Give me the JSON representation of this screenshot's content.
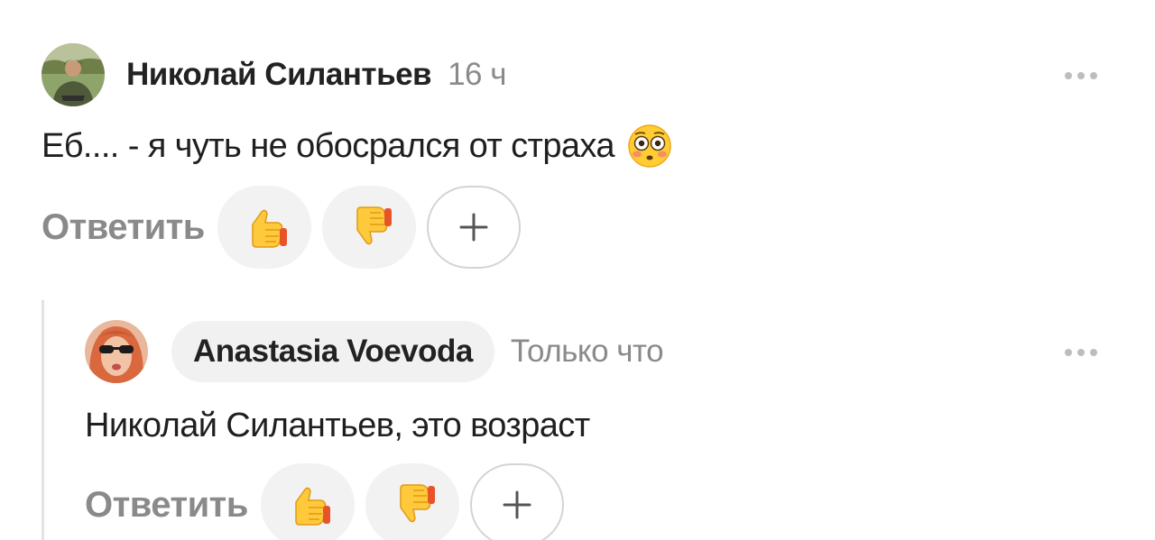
{
  "comments": [
    {
      "author": "Николай Силантьев",
      "time": "16 ч",
      "text": "Еб.... - я чуть не обосрался от страха",
      "text_emoji": "flushed-face",
      "reply_label": "Ответить",
      "reactions": [
        "thumbs-up",
        "thumbs-down"
      ],
      "add_reaction_label": "+"
    },
    {
      "author": "Anastasia Voevoda",
      "time": "Только что",
      "text": "Николай Силантьев, это возраст",
      "reply_label": "Ответить",
      "reactions": [
        "thumbs-up",
        "thumbs-down"
      ],
      "add_reaction_label": "+"
    }
  ],
  "colors": {
    "author": "#222222",
    "muted": "#8a8a8a",
    "reaction_bg": "#f2f2f2",
    "thread_line": "#e3e3e3"
  }
}
